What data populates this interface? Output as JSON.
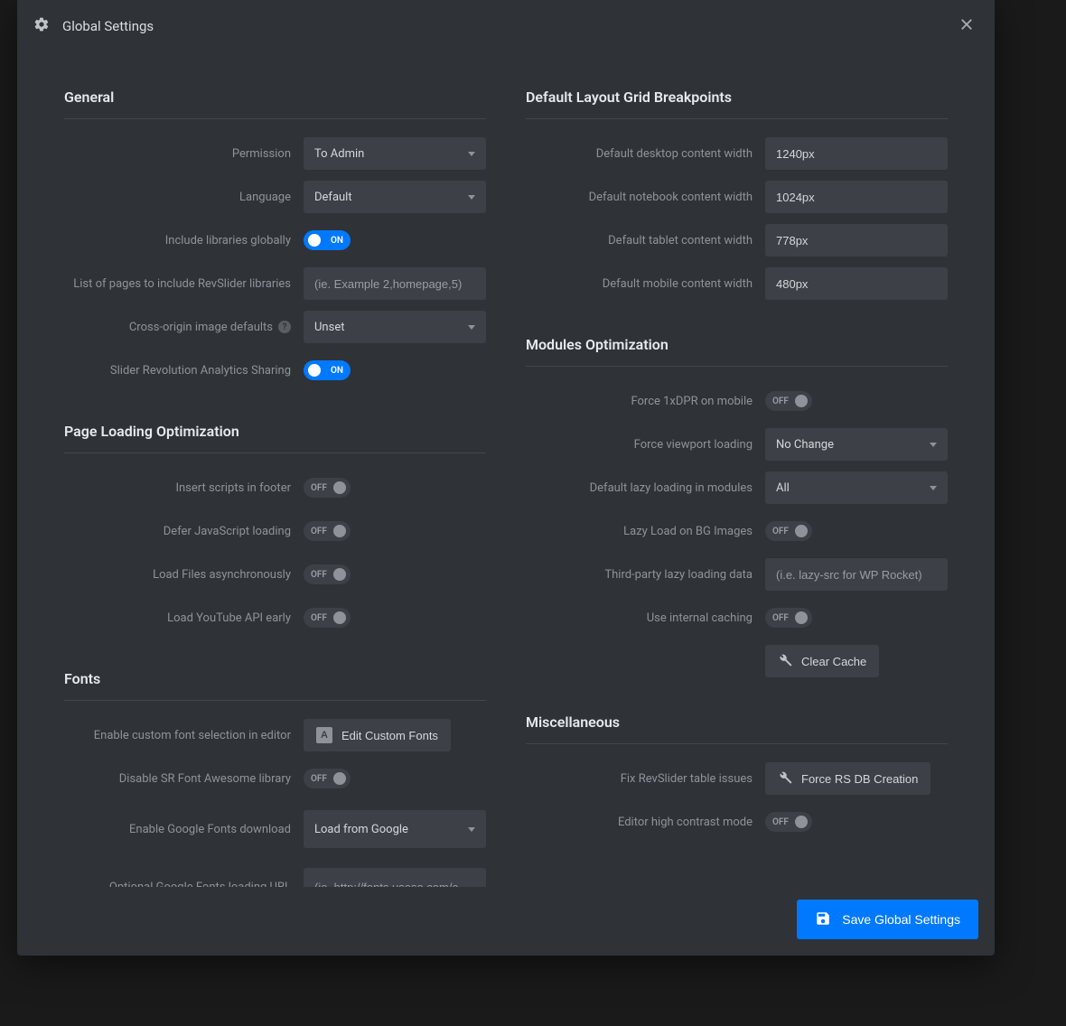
{
  "modal": {
    "title": "Global Settings",
    "save_button": "Save Global Settings"
  },
  "toggle": {
    "on": "ON",
    "off": "OFF"
  },
  "general": {
    "heading": "General",
    "permission_label": "Permission",
    "permission_value": "To Admin",
    "language_label": "Language",
    "language_value": "Default",
    "include_libs_label": "Include libraries globally",
    "pages_list_label": "List of pages to include RevSlider libraries",
    "pages_list_placeholder": "(ie. Example 2,homepage,5)",
    "cross_origin_label": "Cross-origin image defaults",
    "cross_origin_value": "Unset",
    "analytics_label": "Slider Revolution Analytics Sharing"
  },
  "page_loading": {
    "heading": "Page Loading Optimization",
    "footer_scripts_label": "Insert scripts in footer",
    "defer_js_label": "Defer JavaScript loading",
    "async_files_label": "Load Files asynchronously",
    "youtube_api_label": "Load YouTube API early"
  },
  "fonts": {
    "heading": "Fonts",
    "custom_font_label": "Enable custom font selection in editor",
    "edit_fonts_button": "Edit Custom Fonts",
    "disable_fa_label": "Disable SR Font Awesome library",
    "google_fonts_label": "Enable Google Fonts download",
    "google_fonts_value": "Load from Google",
    "gf_url_label": "Optional Google Fonts loading URL",
    "gf_url_placeholder": "(ie. http://fonts.useso.com/c"
  },
  "breakpoints": {
    "heading": "Default Layout Grid Breakpoints",
    "desktop_label": "Default desktop content width",
    "desktop_value": "1240px",
    "notebook_label": "Default notebook content width",
    "notebook_value": "1024px",
    "tablet_label": "Default tablet content width",
    "tablet_value": "778px",
    "mobile_label": "Default mobile content width",
    "mobile_value": "480px"
  },
  "modules": {
    "heading": "Modules Optimization",
    "dpr_label": "Force 1xDPR on mobile",
    "viewport_label": "Force viewport loading",
    "viewport_value": "No Change",
    "lazy_default_label": "Default lazy loading in modules",
    "lazy_default_value": "All",
    "lazy_bg_label": "Lazy Load on BG Images",
    "third_party_label": "Third-party lazy loading data",
    "third_party_placeholder": "(i.e. lazy-src for WP Rocket)",
    "caching_label": "Use internal caching",
    "clear_cache_button": "Clear Cache"
  },
  "misc": {
    "heading": "Miscellaneous",
    "fix_table_label": "Fix RevSlider table issues",
    "force_db_button": "Force RS DB Creation",
    "contrast_label": "Editor high contrast mode"
  }
}
